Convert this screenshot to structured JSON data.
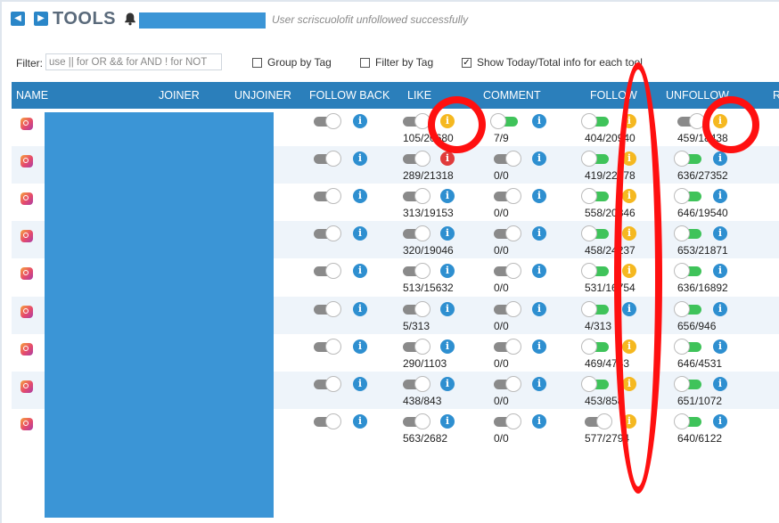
{
  "header": {
    "title": "TOOLS",
    "notification": "User scriscuolofit unfollowed successfully",
    "prev_icon": "triangle-left",
    "next_icon": "triangle-right",
    "bell_icon": "bell"
  },
  "filter": {
    "label": "Filter:",
    "placeholder": "use || for OR && for AND ! for NOT",
    "options": [
      {
        "label": "Group by Tag",
        "checked": false
      },
      {
        "label": "Filter by Tag",
        "checked": false
      },
      {
        "label": "Show Today/Total info for each tool",
        "checked": true
      }
    ]
  },
  "columns": [
    "NAME",
    "JOINER",
    "UNJOINER",
    "FOLLOW BACK",
    "LIKE",
    "COMMENT",
    "FOLLOW",
    "UNFOLLOW",
    "R"
  ],
  "rows": [
    {
      "like": "105/20680",
      "comment": "7/9",
      "follow": "404/20940",
      "unfollow": "459/18438"
    },
    {
      "like": "289/21318",
      "comment": "0/0",
      "follow": "419/22478",
      "unfollow": "636/27352"
    },
    {
      "like": "313/19153",
      "comment": "0/0",
      "follow": "558/20346",
      "unfollow": "646/19540"
    },
    {
      "like": "320/19046",
      "comment": "0/0",
      "follow": "458/24237",
      "unfollow": "653/21871"
    },
    {
      "like": "513/15632",
      "comment": "0/0",
      "follow": "531/16754",
      "unfollow": "636/16892"
    },
    {
      "like": "5/313",
      "comment": "0/0",
      "follow": "4/313",
      "unfollow": "656/946"
    },
    {
      "like": "290/1103",
      "comment": "0/0",
      "follow": "469/4743",
      "unfollow": "646/4531"
    },
    {
      "like": "438/843",
      "comment": "0/0",
      "follow": "453/858",
      "unfollow": "651/1072"
    },
    {
      "like": "563/2682",
      "comment": "0/0",
      "follow": "577/2794",
      "unfollow": "640/6122"
    }
  ],
  "colors": {
    "header_bar": "#2b7fbb",
    "toggle_on": "#3fc35a",
    "toggle_off": "#8a8a8a",
    "info_blue": "#2e8fd0",
    "info_yellow": "#f5b820",
    "info_red": "#e03b3b",
    "annotation": "#ff1010",
    "redaction": "#3b95d6"
  }
}
